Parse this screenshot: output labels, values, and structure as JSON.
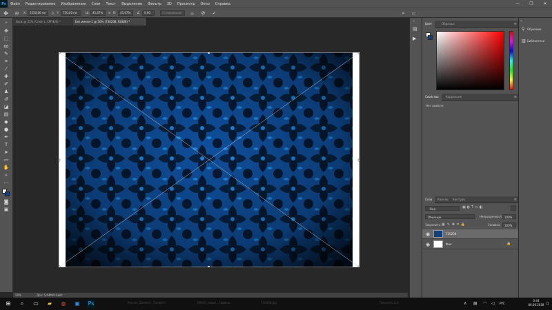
{
  "app": {
    "logo": "Ps",
    "menu": [
      "Файл",
      "Редактирование",
      "Изображение",
      "Слои",
      "Текст",
      "Выделение",
      "Фильтр",
      "3D",
      "Просмотр",
      "Окно",
      "Справка"
    ],
    "window_controls": [
      "—",
      "❐",
      "✕"
    ]
  },
  "options_bar": {
    "ref_point_icon": "reference-point-icon",
    "x_label": "X:",
    "x_value": "2250,00 пи",
    "y_label": "Y:",
    "y_value": "750,00 пи",
    "w_label": "Ш:",
    "w_value": "45,67%",
    "h_label": "В:",
    "h_value": "45,67%",
    "angle_value": "0,00",
    "interp_value": "Сглаживание",
    "cancel_icon": "cancel-icon",
    "commit_icon": "commit-icon"
  },
  "tabs": [
    {
      "label": "Book @ 25% (Слой 1, CMYK/8) *",
      "active": false
    },
    {
      "label": "Без имени-1 @ 50% (730208, RGB/8) *",
      "active": true
    }
  ],
  "status_bar": {
    "zoom": "50%",
    "doc_info": "Док: 5,64М/0 байт"
  },
  "color_panel": {
    "tabs": [
      "Цвет",
      "Образцы"
    ],
    "fg": "#ffffff",
    "bg": "#0e3f8a"
  },
  "properties_panel": {
    "tabs": [
      "Свойства",
      "Коррекция"
    ],
    "empty_text": "Нет свойств"
  },
  "layers_panel": {
    "tabs": [
      "Слои",
      "Каналы",
      "Контуры"
    ],
    "filter_label": "Вид",
    "blend_mode": "Обычные",
    "opacity_label": "Непрозрачность:",
    "opacity_value": "100%",
    "lock_label": "Закрепить:",
    "fill_label": "Заливка:",
    "fill_value": "100%",
    "layers": [
      {
        "name": "730208",
        "selected": true,
        "thumb_color": "#12407a"
      },
      {
        "name": "Фон",
        "selected": false,
        "thumb_color": "#ffffff"
      }
    ]
  },
  "learn_panel": {
    "items": [
      {
        "label": "Обучение",
        "icon": "lightbulb-icon"
      },
      {
        "label": "Библиотеки",
        "icon": "libraries-icon"
      }
    ]
  },
  "taskbar": {
    "ghost_items": [
      "Keyvan_Damiani...Тапайте",
      "ЗАКАЗ_новых...Тайинш",
      "730208.jpg",
      "Показать все"
    ],
    "lang": "РУС",
    "time": "0:44",
    "date": "06.06.2018"
  },
  "colors": {
    "pattern_dark": "#071a33",
    "pattern_mid": "#0f4f9c",
    "pattern_light": "#1e86e0"
  }
}
